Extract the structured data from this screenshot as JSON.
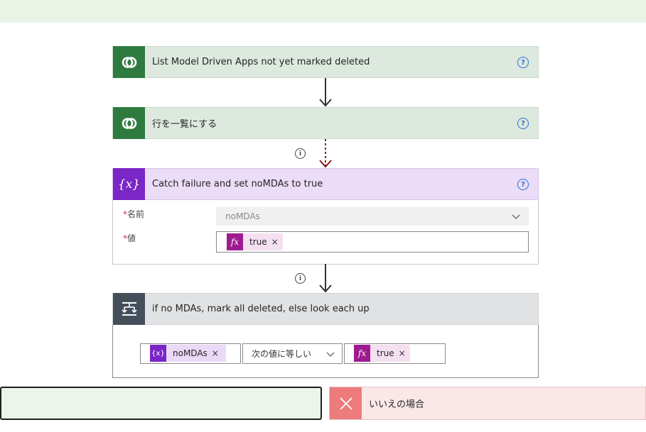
{
  "steps": [
    {
      "title": "List Model Driven Apps not yet marked deleted",
      "icon": "dataverse-icon",
      "help": "?"
    },
    {
      "title": "行を一覧にする",
      "icon": "dataverse-icon",
      "help": "?"
    },
    {
      "title": "Catch failure and set noMDAs to true",
      "icon": "variable-icon",
      "help": "?",
      "fields": {
        "name_label": "名前",
        "name_value": "noMDAs",
        "value_label": "値",
        "value_token": "true"
      }
    },
    {
      "title": "if no MDAs, mark all deleted, else look each up",
      "icon": "condition-icon",
      "condition": {
        "left_token": "noMDAs",
        "operator": "次の値に等しい",
        "right_token": "true"
      }
    }
  ],
  "tokens": {
    "fx_icon": "fx",
    "var_icon": "{x}",
    "remove": "×"
  },
  "required_mark": "*",
  "info_glyph": "i",
  "branches": {
    "yes_label": "",
    "no_label": "いいえの場合"
  },
  "colors": {
    "dataverse": "#2f7a3f",
    "variable": "#7b26c7",
    "condition": "#454f5b",
    "expression": "#9e1b8f",
    "no_branch": "#ed7b7b",
    "run_after_arrow": "#8b1a1a"
  }
}
